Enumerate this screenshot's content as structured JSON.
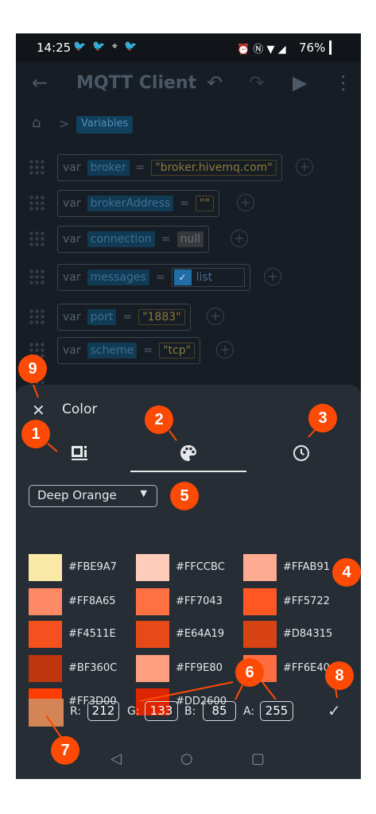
{
  "status_bar": {
    "time": "14:25",
    "left_icons": "🐦 🐦 ⌖ 🐦",
    "right_icons": "⏰ Ⓝ ▼ ◢",
    "battery": "76% ▎"
  },
  "app_bar": {
    "title": "MQTT Client",
    "back_icon": "←",
    "undo_icon": "↶",
    "redo_icon": "↷",
    "run_icon": "▶",
    "more_icon": "⋮"
  },
  "breadcrumb": {
    "home_icon": "⌂",
    "separator": ">",
    "current": "Variables"
  },
  "variables": [
    {
      "keyword": "var",
      "name": "broker",
      "eq": "=",
      "value": "\"broker.hivemq.com\"",
      "kind": "string"
    },
    {
      "keyword": "var",
      "name": "brokerAddress",
      "eq": "=",
      "value": "\"\"",
      "kind": "string"
    },
    {
      "keyword": "var",
      "name": "connection",
      "eq": "=",
      "value": "null",
      "kind": "null"
    },
    {
      "keyword": "var",
      "name": "messages",
      "eq": "=",
      "value": "list",
      "kind": "list"
    },
    {
      "keyword": "var",
      "name": "port",
      "eq": "=",
      "value": "\"1883\"",
      "kind": "string"
    },
    {
      "keyword": "var",
      "name": "scheme",
      "eq": "=",
      "value": "\"tcp\"",
      "kind": "string"
    }
  ],
  "color_sheet": {
    "title": "Color",
    "close_icon": "✕",
    "confirm_icon": "✓",
    "palette_name": "Deep Orange",
    "palette_arrow": "▼",
    "swatches": [
      {
        "hex": "#FBE9A7",
        "color": "#FBE9A7"
      },
      {
        "hex": "#FFCCBC",
        "color": "#FFCCBC"
      },
      {
        "hex": "#FFAB91",
        "color": "#FFAB91"
      },
      {
        "hex": "#FF8A65",
        "color": "#FF8A65"
      },
      {
        "hex": "#FF7043",
        "color": "#FF7043"
      },
      {
        "hex": "#FF5722",
        "color": "#FF5722"
      },
      {
        "hex": "#F4511E",
        "color": "#F4511E"
      },
      {
        "hex": "#E64A19",
        "color": "#E64A19"
      },
      {
        "hex": "#D84315",
        "color": "#D84315"
      },
      {
        "hex": "#BF360C",
        "color": "#BF360C"
      },
      {
        "hex": "#FF9E80",
        "color": "#FF9E80"
      },
      {
        "hex": "#FF6E40",
        "color": "#FF6E40"
      },
      {
        "hex": "#FF3D00",
        "color": "#FF3D00"
      },
      {
        "hex": "#DD2600",
        "color": "#DD2600"
      }
    ],
    "custom": {
      "preview_color": "#D48555",
      "r_label": "R:",
      "r": "212",
      "g_label": "G:",
      "g": "133",
      "b_label": "B:",
      "b": "85",
      "a_label": "A:",
      "a": "255"
    }
  },
  "nav_bar": {
    "back": "◁",
    "home": "○",
    "recents": "▢"
  },
  "callouts": [
    "1",
    "2",
    "3",
    "4",
    "5",
    "6",
    "7",
    "8",
    "9"
  ],
  "colors": {
    "accent": "#FF4A04",
    "sheet_bg": "#262D35",
    "app_bg": "#171D24"
  }
}
